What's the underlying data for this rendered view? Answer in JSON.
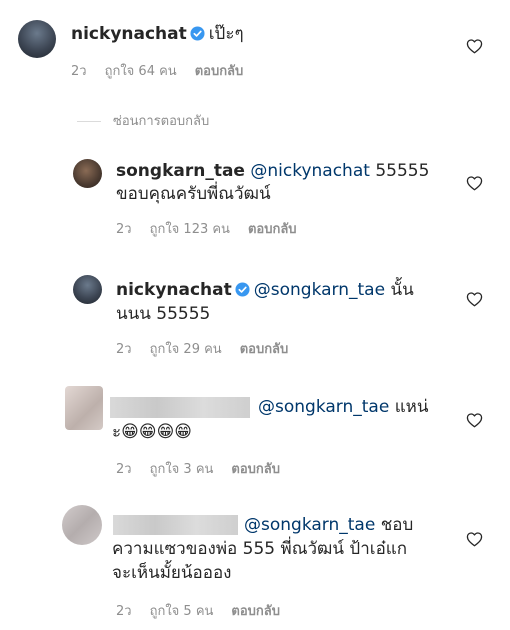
{
  "comments": [
    {
      "username": "nickynachat",
      "verified": true,
      "text1": "เป๊ะๆ",
      "time": "2ว",
      "likes": "ถูกใจ 64 คน",
      "reply": "ตอบกลับ"
    },
    {
      "username": "songkarn_tae",
      "mention": "@nickynachat",
      "text1": " 55555",
      "text2": "ขอบคุณครับพี่ณวัฒน์",
      "time": "2ว",
      "likes": "ถูกใจ 123 คน",
      "reply": "ตอบกลับ"
    },
    {
      "username": "nickynachat",
      "verified": true,
      "mention": "@songkarn_tae",
      "text1": " นั้น",
      "text2": "นนน 55555",
      "time": "2ว",
      "likes": "ถูกใจ 29 คน",
      "reply": "ตอบกลับ"
    },
    {
      "mention": "@songkarn_tae",
      "text1": " แหน่",
      "text2": "ะ😁😁😁😁",
      "time": "2ว",
      "likes": "ถูกใจ 3 คน",
      "reply": "ตอบกลับ"
    },
    {
      "mention": "@songkarn_tae",
      "text1": " ชอบ",
      "text2": "ความแซวของพ่อ 555 พี่ณวัฒน์ ป้าเอ๋แก",
      "text3": "จะเห็นมั้ยน้อออง",
      "time": "2ว",
      "likes": "ถูกใจ 5 คน",
      "reply": "ตอบกลับ"
    }
  ],
  "hide_replies": "ซ่อนการตอบกลับ",
  "icons": {
    "like": "heart-outline-icon",
    "verified": "verified-badge-icon"
  },
  "colors": {
    "username": "#262626",
    "mention": "#00376b",
    "meta": "#8e8e8e",
    "verified": "#3897f0"
  }
}
